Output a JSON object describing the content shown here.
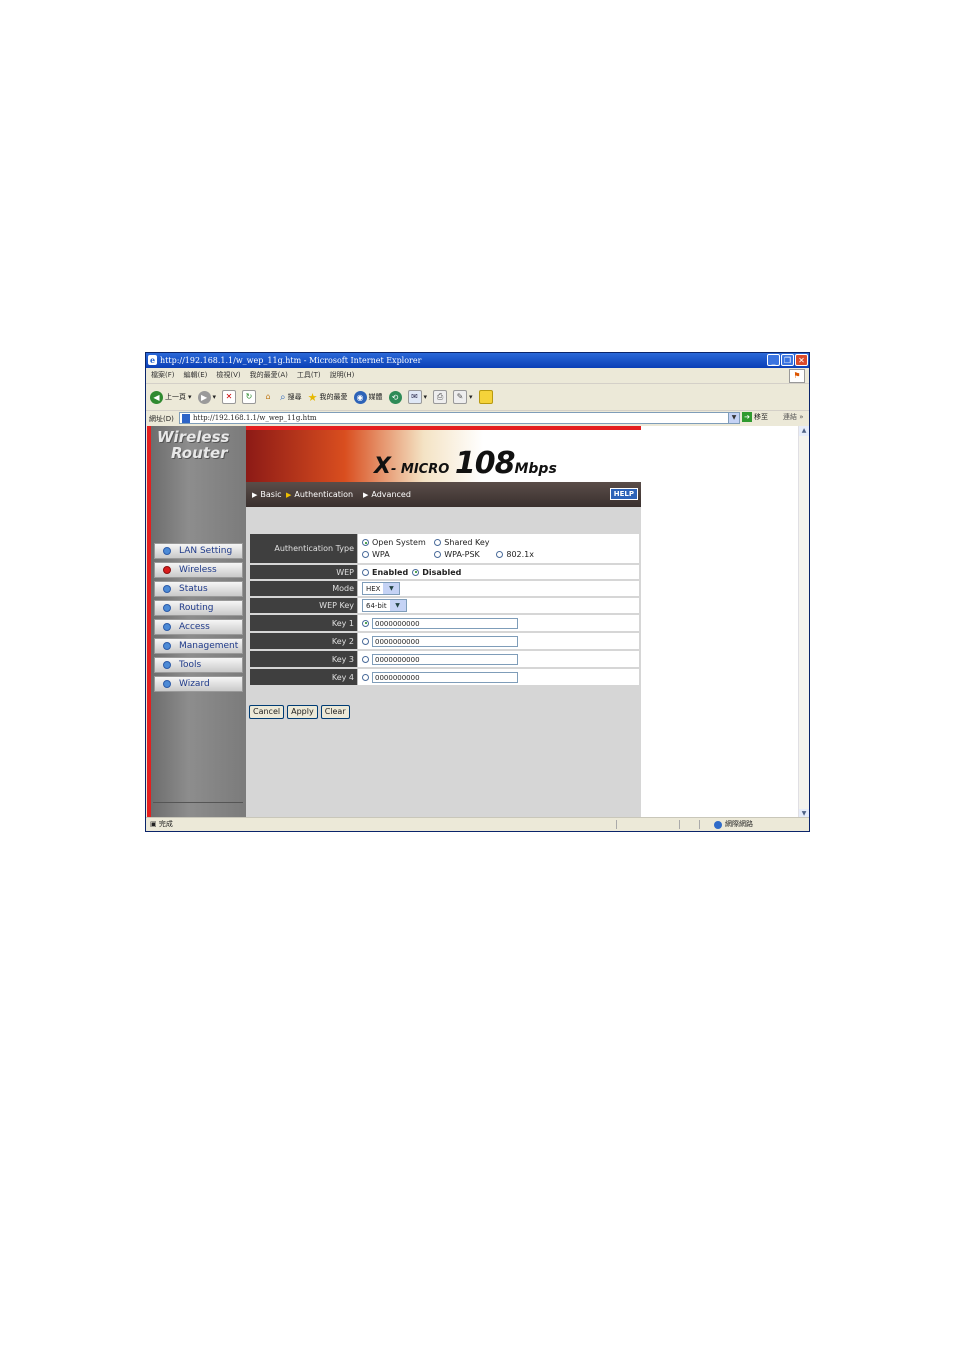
{
  "window": {
    "title": "http://192.168.1.1/w_wep_11g.htm - Microsoft Internet Explorer"
  },
  "menu": [
    "檔案(F)",
    "編輯(E)",
    "檢視(V)",
    "我的最愛(A)",
    "工具(T)",
    "說明(H)"
  ],
  "toolbar": {
    "back": "上一頁",
    "search": "搜尋",
    "favorites": "我的最愛",
    "media": "媒體"
  },
  "address": {
    "label": "網址(D)",
    "url": "http://192.168.1.1/w_wep_11g.htm",
    "go": "移至",
    "links": "連結"
  },
  "sidebar": {
    "brand_line1": "Wireless",
    "brand_line2": "Router",
    "items": [
      {
        "label": "LAN Setting"
      },
      {
        "label": "Wireless"
      },
      {
        "label": "Status"
      },
      {
        "label": "Routing"
      },
      {
        "label": "Access"
      },
      {
        "label": "Management"
      },
      {
        "label": "Tools"
      },
      {
        "label": "Wizard"
      }
    ]
  },
  "banner": {
    "x": "X",
    "micro": "- MICRO",
    "speed": "108",
    "unit": "Mbps"
  },
  "tabs": {
    "basic": "Basic",
    "authentication": "Authentication",
    "advanced": "Advanced",
    "help": "HELP"
  },
  "form": {
    "auth_type": {
      "label": "Authentication Type",
      "options": [
        "Open System",
        "Shared Key",
        "WPA",
        "WPA-PSK",
        "802.1x"
      ],
      "selected": "Open System"
    },
    "wep": {
      "label": "WEP",
      "enabled": "Enabled",
      "disabled": "Disabled",
      "selected": "Disabled"
    },
    "mode": {
      "label": "Mode",
      "value": "HEX"
    },
    "wep_key": {
      "label": "WEP Key",
      "value": "64-bit"
    },
    "keys": [
      {
        "label": "Key 1",
        "value": "0000000000"
      },
      {
        "label": "Key 2",
        "value": "0000000000"
      },
      {
        "label": "Key 3",
        "value": "0000000000"
      },
      {
        "label": "Key 4",
        "value": "0000000000"
      }
    ],
    "selected_key": "Key 1"
  },
  "buttons": {
    "cancel": "Cancel",
    "apply": "Apply",
    "clear": "Clear"
  },
  "status": {
    "left": "完成",
    "zone": "網際網路"
  }
}
